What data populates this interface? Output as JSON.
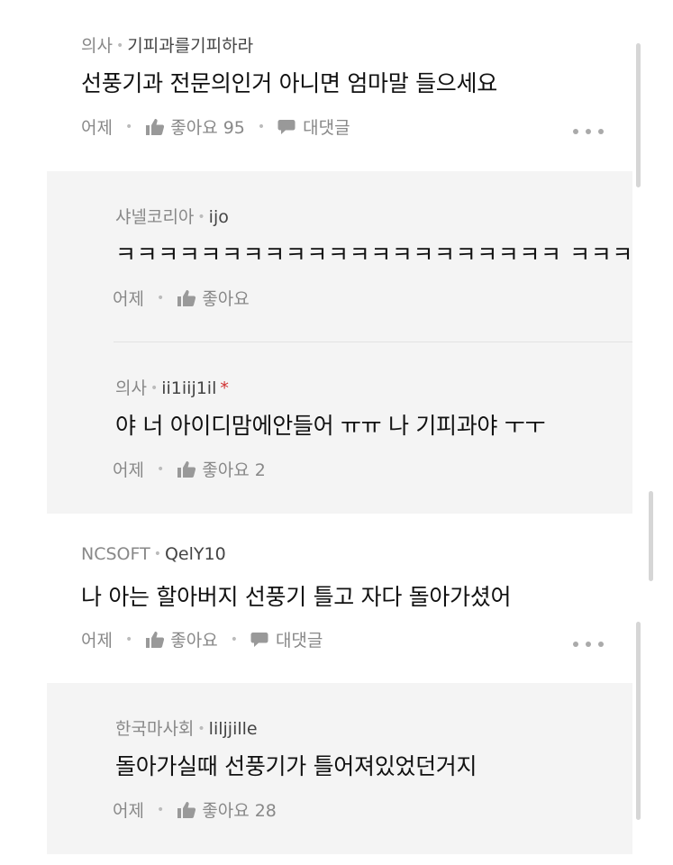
{
  "comments": [
    {
      "company": "의사",
      "nickname": "기피과를기피하라",
      "text": "선풍기과 전문의인거 아니면 엄마말 들으세요",
      "time": "어제",
      "like_label": "좋아요 95",
      "reply_label": "대댓글"
    },
    {
      "company": "샤넬코리아",
      "nickname": "ijo",
      "text": "ㅋㅋㅋㅋㅋㅋㅋㅋㅋㅋㅋㅋㅋㅋㅋㅋㅋㅋㅋㅋㅋ ㅋㅋㅋ",
      "time": "어제",
      "like_label": "좋아요"
    },
    {
      "company": "의사",
      "nickname": "ii1iij1il",
      "star": "*",
      "text": "야 너 아이디맘에안들어 ㅠㅠ 나 기피과야 ㅜㅜ",
      "time": "어제",
      "like_label": "좋아요 2"
    },
    {
      "company": "NCSOFT",
      "nickname": "QelY10",
      "text": "나 아는 할아버지 선풍기 틀고 자다 돌아가셨어",
      "time": "어제",
      "like_label": "좋아요",
      "reply_label": "대댓글"
    },
    {
      "company": "한국마사회",
      "nickname": "liljjille",
      "text": "돌아가실때 선풍기가 틀어져있었던거지",
      "time": "어제",
      "like_label": "좋아요 28"
    }
  ],
  "icons": {
    "like": "thumbs-up-icon",
    "reply": "speech-bubble-icon",
    "more": "more-options-icon"
  },
  "colors": {
    "reply_background": "#f4f4f4",
    "meta_text": "#888888",
    "nickname_text": "#444444",
    "star": "#d03030"
  }
}
